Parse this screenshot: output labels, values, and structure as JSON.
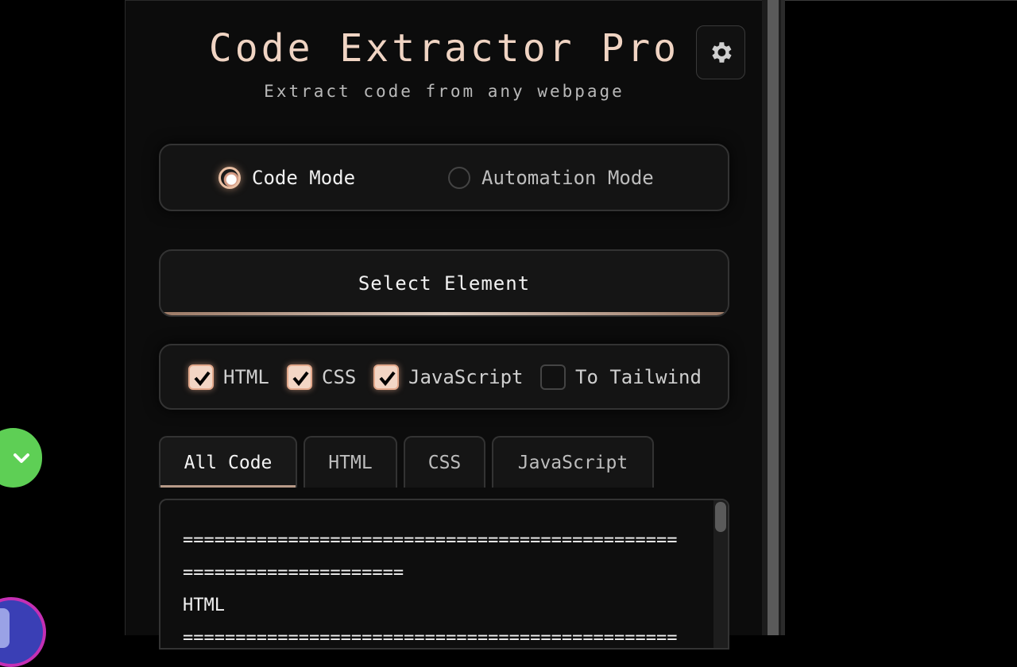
{
  "header": {
    "title": "Code Extractor Pro",
    "subtitle": "Extract code from any webpage",
    "settings_icon": "gear-icon"
  },
  "modes": {
    "code_label": "Code Mode",
    "automation_label": "Automation Mode",
    "selected": "Code Mode"
  },
  "actions": {
    "select_element_label": "Select Element"
  },
  "options": [
    {
      "label": "HTML",
      "checked": true
    },
    {
      "label": "CSS",
      "checked": true
    },
    {
      "label": "JavaScript",
      "checked": true
    },
    {
      "label": "To Tailwind",
      "checked": false
    }
  ],
  "tabs": [
    {
      "label": "All Code",
      "active": true
    },
    {
      "label": "HTML",
      "active": false
    },
    {
      "label": "CSS",
      "active": false
    },
    {
      "label": "JavaScript",
      "active": false
    }
  ],
  "code": {
    "text": "===============================================\n=====================\nHTML\n==============================================="
  },
  "colors": {
    "accent": "#f0d4c3",
    "checkbox_fill": "#f3d6c5",
    "fab_green": "#5ecf55"
  }
}
